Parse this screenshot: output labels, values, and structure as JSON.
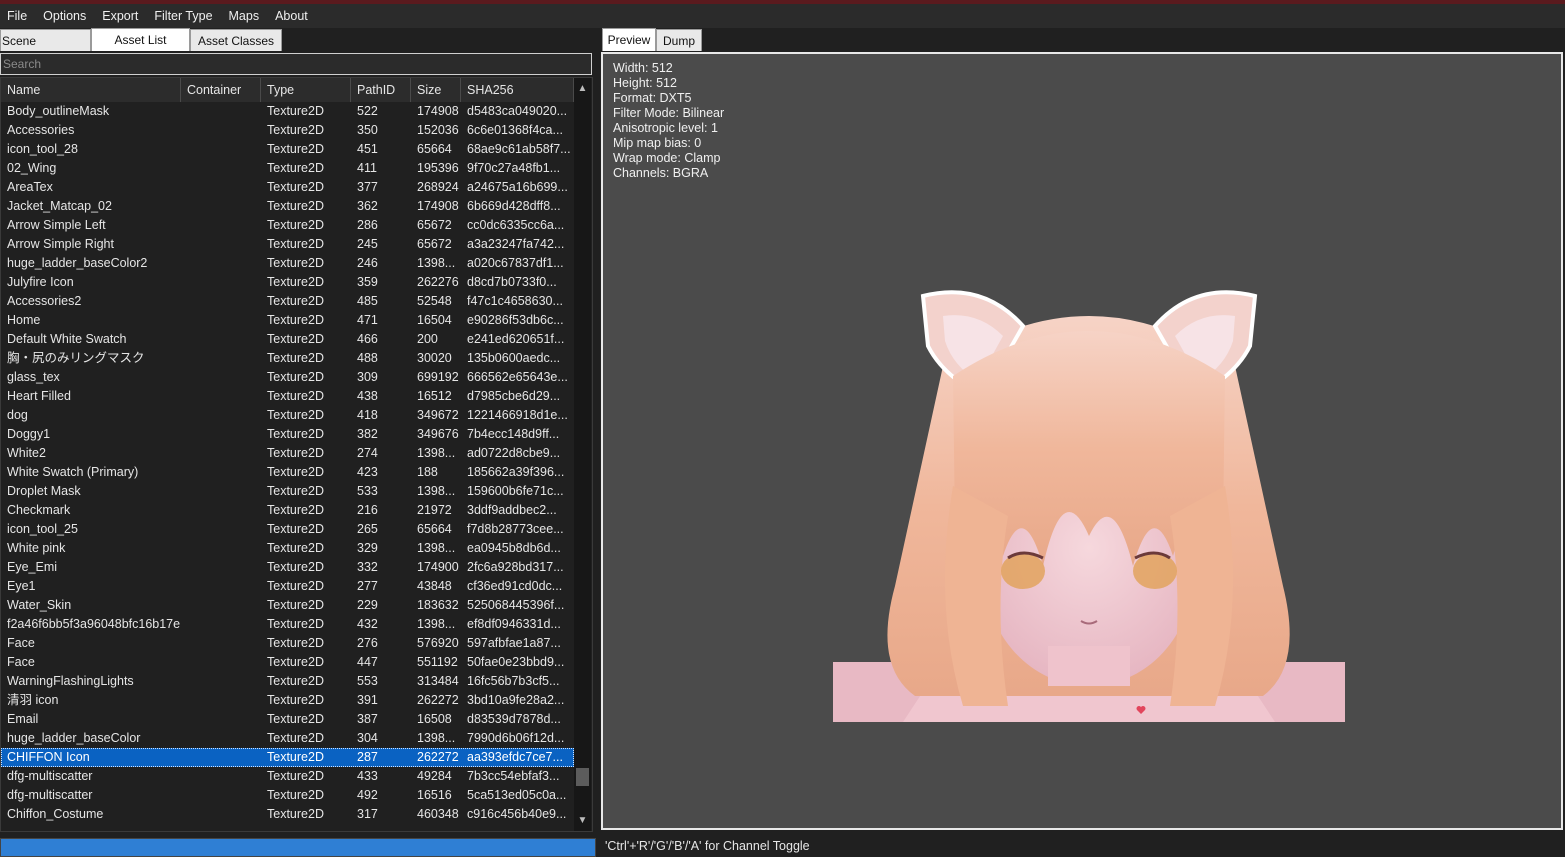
{
  "menu": [
    "File",
    "Options",
    "Export",
    "Filter Type",
    "Maps",
    "About"
  ],
  "left_tabs": [
    "Scene Hierarchy",
    "Asset List",
    "Asset Classes"
  ],
  "search": {
    "placeholder": "Search"
  },
  "columns": [
    "Name",
    "Container",
    "Type",
    "PathID",
    "Size",
    "SHA256"
  ],
  "rows": [
    [
      "Body_outlineMask",
      "",
      "Texture2D",
      "522",
      "174908",
      "d5483ca049020..."
    ],
    [
      "Accessories",
      "",
      "Texture2D",
      "350",
      "152036",
      "6c6e01368f4ca..."
    ],
    [
      "icon_tool_28",
      "",
      "Texture2D",
      "451",
      "65664",
      "68ae9c61ab58f7..."
    ],
    [
      "02_Wing",
      "",
      "Texture2D",
      "411",
      "195396",
      "9f70c27a48fb1..."
    ],
    [
      "AreaTex",
      "",
      "Texture2D",
      "377",
      "268924",
      "a24675a16b699..."
    ],
    [
      "Jacket_Matcap_02",
      "",
      "Texture2D",
      "362",
      "174908",
      "6b669d428dff8..."
    ],
    [
      "Arrow Simple Left",
      "",
      "Texture2D",
      "286",
      "65672",
      "cc0dc6335cc6a..."
    ],
    [
      "Arrow Simple Right",
      "",
      "Texture2D",
      "245",
      "65672",
      "a3a23247fa742..."
    ],
    [
      "huge_ladder_baseColor2",
      "",
      "Texture2D",
      "246",
      "1398...",
      "a020c67837df1..."
    ],
    [
      "Julyfire Icon",
      "",
      "Texture2D",
      "359",
      "262276",
      "d8cd7b0733f0..."
    ],
    [
      "Accessories2",
      "",
      "Texture2D",
      "485",
      "52548",
      "f47c1c4658630..."
    ],
    [
      "Home",
      "",
      "Texture2D",
      "471",
      "16504",
      "e90286f53db6c..."
    ],
    [
      "Default White Swatch",
      "",
      "Texture2D",
      "466",
      "200",
      "e241ed620651f..."
    ],
    [
      "胸・尻のみリングマスク",
      "",
      "Texture2D",
      "488",
      "30020",
      "135b0600aedc..."
    ],
    [
      "glass_tex",
      "",
      "Texture2D",
      "309",
      "699192",
      "666562e65643e..."
    ],
    [
      "Heart Filled",
      "",
      "Texture2D",
      "438",
      "16512",
      "d7985cbe6d29..."
    ],
    [
      "dog",
      "",
      "Texture2D",
      "418",
      "349672",
      "1221466918d1e..."
    ],
    [
      "Doggy1",
      "",
      "Texture2D",
      "382",
      "349676",
      "7b4ecc148d9ff..."
    ],
    [
      "White2",
      "",
      "Texture2D",
      "274",
      "1398...",
      "ad0722d8cbe9..."
    ],
    [
      "White Swatch (Primary)",
      "",
      "Texture2D",
      "423",
      "188",
      "185662a39f396..."
    ],
    [
      "Droplet Mask",
      "",
      "Texture2D",
      "533",
      "1398...",
      "159600b6fe71c..."
    ],
    [
      "Checkmark",
      "",
      "Texture2D",
      "216",
      "21972",
      "3ddf9addbec2..."
    ],
    [
      "icon_tool_25",
      "",
      "Texture2D",
      "265",
      "65664",
      "f7d8b28773cee..."
    ],
    [
      "White pink",
      "",
      "Texture2D",
      "329",
      "1398...",
      "ea0945b8db6d..."
    ],
    [
      "Eye_Emi",
      "",
      "Texture2D",
      "332",
      "174900",
      "2fc6a928bd317..."
    ],
    [
      "Eye1",
      "",
      "Texture2D",
      "277",
      "43848",
      "cf36ed91cd0dc..."
    ],
    [
      "Water_Skin",
      "",
      "Texture2D",
      "229",
      "183632",
      "525068445396f..."
    ],
    [
      "f2a46f6bb5f3a96048bfc16b17e...",
      "",
      "Texture2D",
      "432",
      "1398...",
      "ef8df0946331d..."
    ],
    [
      "Face",
      "",
      "Texture2D",
      "276",
      "576920",
      "597afbfae1a87..."
    ],
    [
      "Face",
      "",
      "Texture2D",
      "447",
      "551192",
      "50fae0e23bbd9..."
    ],
    [
      "WarningFlashingLights",
      "",
      "Texture2D",
      "553",
      "313484",
      "16fc56b7b3cf5..."
    ],
    [
      "清羽 icon",
      "",
      "Texture2D",
      "391",
      "262272",
      "3bd10a9fe28a2..."
    ],
    [
      "Email",
      "",
      "Texture2D",
      "387",
      "16508",
      "d83539d7878d..."
    ],
    [
      "huge_ladder_baseColor",
      "",
      "Texture2D",
      "304",
      "1398...",
      "7990d6b06f12d..."
    ],
    [
      "CHIFFON Icon",
      "",
      "Texture2D",
      "287",
      "262272",
      "aa393efdc7ce7..."
    ],
    [
      "dfg-multiscatter",
      "",
      "Texture2D",
      "433",
      "49284",
      "7b3cc54ebfaf3..."
    ],
    [
      "dfg-multiscatter",
      "",
      "Texture2D",
      "492",
      "16516",
      "5ca513ed05c0a..."
    ],
    [
      "Chiffon_Costume",
      "",
      "Texture2D",
      "317",
      "460348",
      "c916c456b40e9..."
    ]
  ],
  "selected_row": 34,
  "right_tabs": [
    "Preview",
    "Dump"
  ],
  "texture_info": [
    "Width: 512",
    "Height: 512",
    "Format: DXT5",
    "Filter Mode: Bilinear",
    "Anisotropic level: 1",
    "Mip map bias: 0",
    "Wrap mode: Clamp",
    "Channels: BGRA"
  ],
  "status_text": "'Ctrl'+'R'/'G'/'B'/'A' for Channel Toggle",
  "colors": {
    "selection": "#0a62c2",
    "progress": "#2f7fd4",
    "preview_bg": "#4b4b4b",
    "title_stripe": "#5a1a1e"
  }
}
